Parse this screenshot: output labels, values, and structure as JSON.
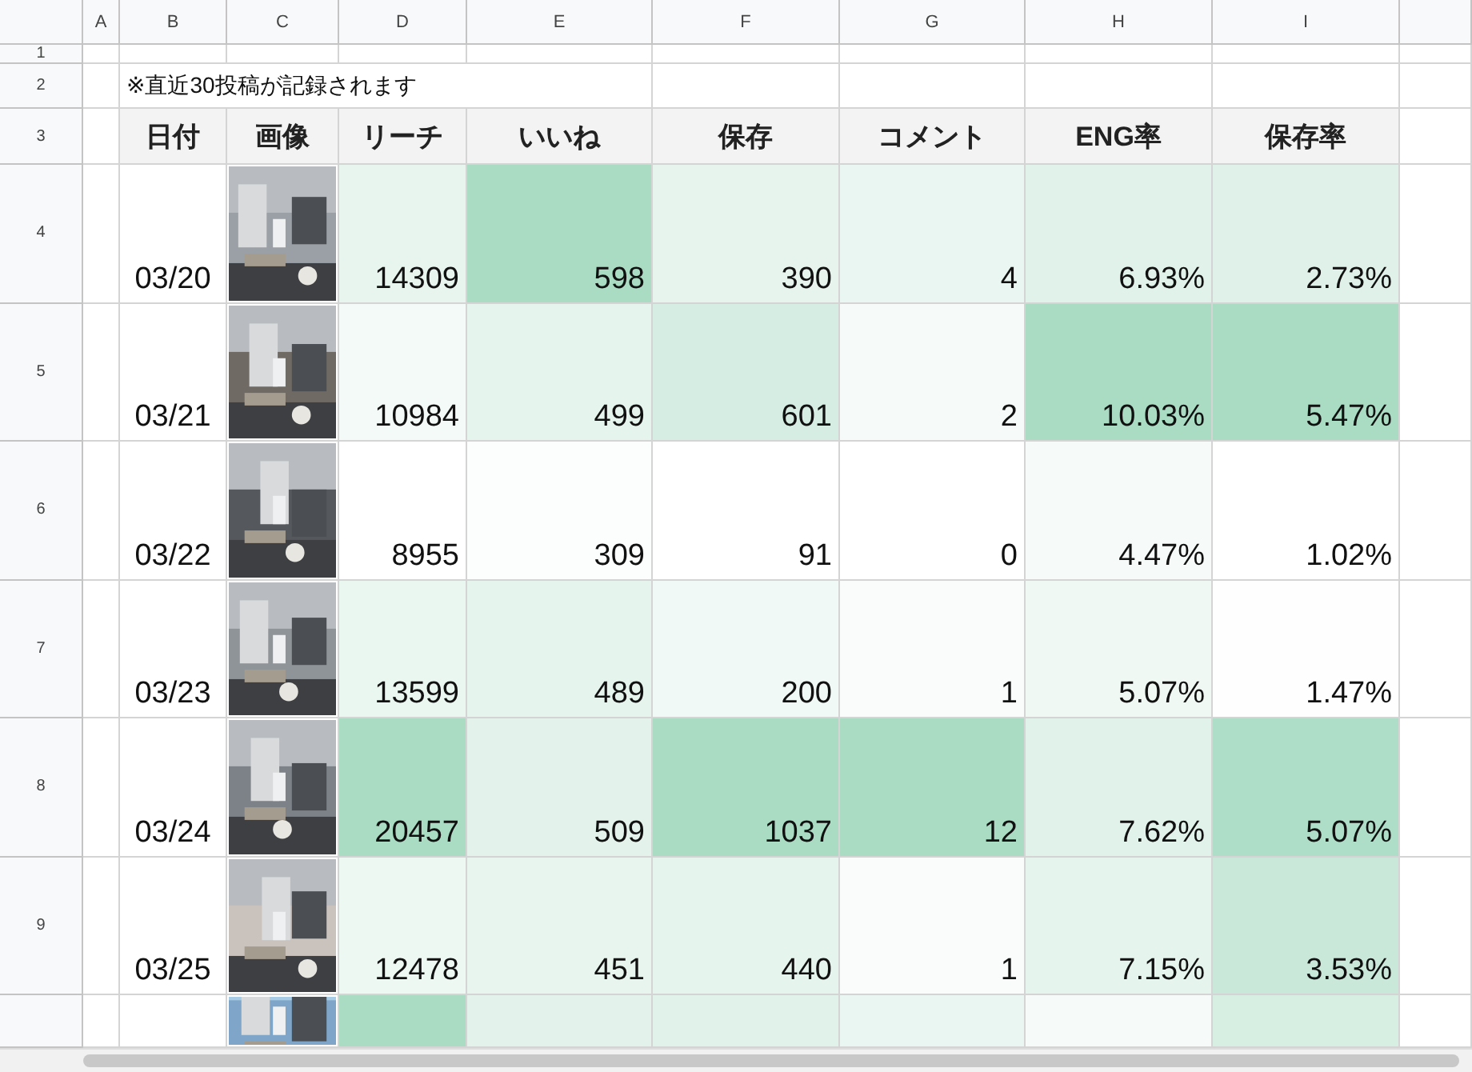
{
  "column_letters": [
    "A",
    "B",
    "C",
    "D",
    "E",
    "F",
    "G",
    "H",
    "I"
  ],
  "rows": [
    {
      "kind": "blank",
      "number": "1"
    },
    {
      "kind": "note",
      "number": "2",
      "note": "※直近30投稿が記録されます"
    },
    {
      "kind": "header",
      "number": "3",
      "headers": [
        "日付",
        "画像",
        "リーチ",
        "いいね",
        "保存",
        "コメント",
        "ENG率",
        "保存率"
      ]
    },
    {
      "kind": "data",
      "number": "4",
      "date": "03/20",
      "cells": [
        {
          "value": "14309",
          "color": "#e8f5ef"
        },
        {
          "value": "598",
          "color": "#a9dcc3"
        },
        {
          "value": "390",
          "color": "#e6f4ed"
        },
        {
          "value": "4",
          "color": "#eaf6f1"
        },
        {
          "value": "6.93%",
          "color": "#e1f2ea"
        },
        {
          "value": "2.73%",
          "color": "#dff1e8"
        }
      ]
    },
    {
      "kind": "data",
      "number": "5",
      "date": "03/21",
      "cells": [
        {
          "value": "10984",
          "color": "#f3faf7"
        },
        {
          "value": "499",
          "color": "#e5f4ed"
        },
        {
          "value": "601",
          "color": "#d5ede2"
        },
        {
          "value": "2",
          "color": "#f6fbf9"
        },
        {
          "value": "10.03%",
          "color": "#a9dcc3"
        },
        {
          "value": "5.47%",
          "color": "#a9dcc3"
        }
      ]
    },
    {
      "kind": "data",
      "number": "6",
      "date": "03/22",
      "cells": [
        {
          "value": "8955",
          "color": "#ffffff"
        },
        {
          "value": "309",
          "color": "#fcfefd"
        },
        {
          "value": "91",
          "color": "#ffffff"
        },
        {
          "value": "0",
          "color": "#ffffff"
        },
        {
          "value": "4.47%",
          "color": "#f6fbf9"
        },
        {
          "value": "1.02%",
          "color": "#ffffff"
        }
      ]
    },
    {
      "kind": "data",
      "number": "7",
      "date": "03/23",
      "cells": [
        {
          "value": "13599",
          "color": "#eaf6f0"
        },
        {
          "value": "489",
          "color": "#e6f4ee"
        },
        {
          "value": "200",
          "color": "#f0f9f5"
        },
        {
          "value": "1",
          "color": "#f9fcfb"
        },
        {
          "value": "5.07%",
          "color": "#f0f8f4"
        },
        {
          "value": "1.47%",
          "color": "#fdfefd"
        }
      ]
    },
    {
      "kind": "data",
      "number": "8",
      "date": "03/24",
      "cells": [
        {
          "value": "20457",
          "color": "#aadcc4"
        },
        {
          "value": "509",
          "color": "#e3f3eb"
        },
        {
          "value": "1037",
          "color": "#aadcc4"
        },
        {
          "value": "12",
          "color": "#aadcc4"
        },
        {
          "value": "7.62%",
          "color": "#e1f2ea"
        },
        {
          "value": "5.07%",
          "color": "#aedec7"
        }
      ]
    },
    {
      "kind": "data",
      "number": "9",
      "date": "03/25",
      "cells": [
        {
          "value": "12478",
          "color": "#eef8f3"
        },
        {
          "value": "451",
          "color": "#e8f5ef"
        },
        {
          "value": "440",
          "color": "#e6f4ee"
        },
        {
          "value": "1",
          "color": "#f9fcfb"
        },
        {
          "value": "7.15%",
          "color": "#e5f4ed"
        },
        {
          "value": "3.53%",
          "color": "#c9e8da"
        }
      ]
    },
    {
      "kind": "partial",
      "cells": [
        {
          "color": "#aadcc4"
        },
        {
          "color": "#e3f3eb"
        },
        {
          "color": "#e1f2ea"
        },
        {
          "color": "#eaf6f1"
        },
        {
          "color": "#f6fbf9"
        },
        {
          "color": "#d7eee3"
        }
      ]
    }
  ]
}
